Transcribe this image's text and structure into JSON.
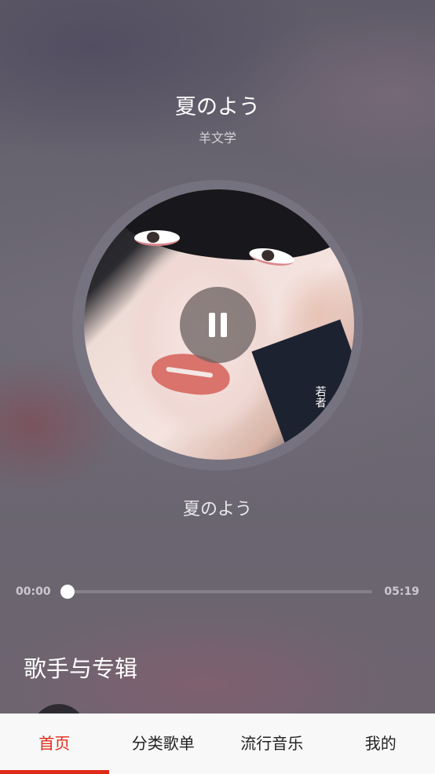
{
  "player": {
    "song_title": "夏のよう",
    "artist": "羊文学",
    "current_lyric": "夏のよう",
    "current_time": "00:00",
    "total_time": "05:19",
    "progress": 0,
    "album_art_text": "若者"
  },
  "section": {
    "title": "歌手与专辑"
  },
  "tabbar": {
    "tabs": [
      {
        "label": "首页",
        "active": true
      },
      {
        "label": "分类歌单",
        "active": false
      },
      {
        "label": "流行音乐",
        "active": false
      },
      {
        "label": "我的",
        "active": false
      }
    ]
  },
  "colors": {
    "accent": "#e02a19",
    "tabbar_bg": "#f8f8f8"
  },
  "icons": {
    "play_state": "pause-icon"
  }
}
